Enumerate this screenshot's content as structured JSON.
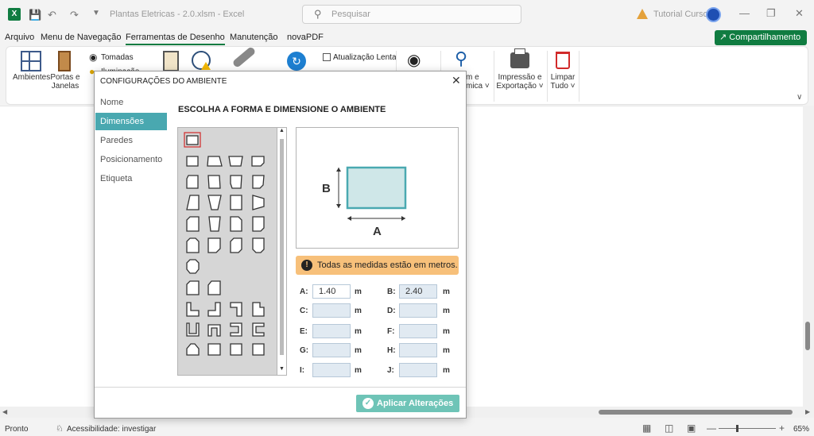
{
  "window": {
    "title": "Plantas Eletricas - 2.0.xlsm  -  Excel",
    "search_placeholder": "Pesquisar",
    "user": "Tutorial Cursos"
  },
  "menu": {
    "tabs": [
      "Arquivo",
      "Menu de Navegação",
      "Ferramentas de Desenho",
      "Manutenção",
      "novaPDF"
    ],
    "share_label": "Compartilhamento"
  },
  "ribbon": {
    "ambientes": "Ambientes",
    "portas": "Portas e",
    "janelas": "Janelas",
    "tomadas": "Tomadas",
    "iluminacao": "Iluminação",
    "atualizacao": "Atualização Lenta",
    "impressao1": "Impressão e",
    "impressao2": "Exportação ˅",
    "limpar1": "Limpar",
    "limpar2": "Tudo ˅",
    "zoom1": "m e",
    "zoom2": "mica ˅"
  },
  "dialog": {
    "title": "CONFIGURAÇÕES DO AMBIENTE",
    "nav": [
      "Nome",
      "Dimensões",
      "Paredes",
      "Posicionamento",
      "Etiqueta"
    ],
    "heading": "ESCOLHA A FORMA E DIMENSIONE O AMBIENTE",
    "preview_a": "A",
    "preview_b": "B",
    "info": "Todas as medidas estão em metros.",
    "unit": "m",
    "fields": [
      {
        "label": "A:",
        "value": "1.40"
      },
      {
        "label": "B:",
        "value": "2.40"
      },
      {
        "label": "C:",
        "value": ""
      },
      {
        "label": "D:",
        "value": ""
      },
      {
        "label": "E:",
        "value": ""
      },
      {
        "label": "F:",
        "value": ""
      },
      {
        "label": "G:",
        "value": ""
      },
      {
        "label": "H:",
        "value": ""
      },
      {
        "label": "I:",
        "value": ""
      },
      {
        "label": "J:",
        "value": ""
      }
    ],
    "apply_label": "Aplicar Alterações"
  },
  "status": {
    "ready": "Pronto",
    "accessibility": "Acessibilidade: investigar",
    "zoom": "65%"
  }
}
